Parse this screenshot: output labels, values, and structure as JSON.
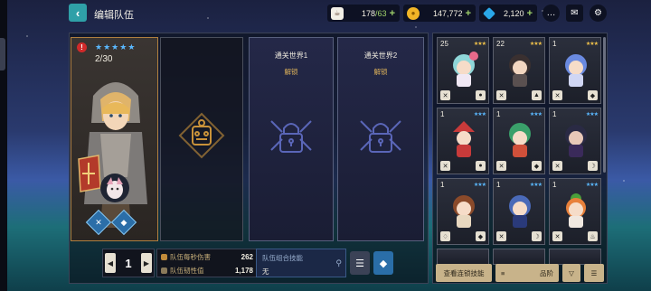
{
  "topbar": {
    "back_icon": "chevron-left-icon",
    "title": "编辑队伍",
    "resources": {
      "stamina": {
        "value": "178",
        "max": "/63",
        "icon": "coffee-icon"
      },
      "gold": {
        "value": "147,772",
        "icon": "gold-coin-icon"
      },
      "gems": {
        "value": "2,120",
        "icon": "gem-icon"
      }
    },
    "icons": [
      "chat-icon",
      "mail-icon",
      "settings-gear-icon"
    ]
  },
  "team": {
    "slots": [
      {
        "type": "hero",
        "level_text": "2/30",
        "star_count": 5,
        "warning": "!"
      },
      {
        "type": "empty",
        "icon": "empty-slot-emblem-icon"
      },
      {
        "type": "locked",
        "title": "通关世界1",
        "status": "解锁",
        "icon": "lock-icon"
      },
      {
        "type": "locked",
        "title": "通关世界2",
        "status": "解锁",
        "icon": "lock-icon"
      }
    ],
    "team_number": "1",
    "stats": [
      {
        "label": "队伍每秒伤害",
        "value": "262"
      },
      {
        "label": "队伍韧性值",
        "value": "1,178"
      }
    ],
    "combo": {
      "label": "队伍组合技能",
      "value": "无"
    }
  },
  "hero_list": [
    {
      "level": "25",
      "stars": "gold",
      "role": "crossed-swords-icon",
      "element": "water-icon"
    },
    {
      "level": "22",
      "stars": "gold",
      "role": "crossed-swords-icon",
      "element": "earth-icon"
    },
    {
      "level": "1",
      "stars": "gold",
      "role": "crossed-swords-icon",
      "element": "basic-icon"
    },
    {
      "level": "1",
      "stars": "blue",
      "role": "crossed-swords-icon",
      "element": "water-icon"
    },
    {
      "level": "1",
      "stars": "blue",
      "role": "crossed-swords-icon",
      "element": "basic-icon"
    },
    {
      "level": "1",
      "stars": "blue",
      "role": "crossed-swords-icon",
      "element": "dark-icon"
    },
    {
      "level": "1",
      "stars": "blue",
      "role": "shield-icon",
      "element": "basic-icon"
    },
    {
      "level": "1",
      "stars": "blue",
      "role": "crossed-swords-icon",
      "element": "dark-icon"
    },
    {
      "level": "1",
      "stars": "blue",
      "role": "crossed-swords-icon",
      "element": "fire-icon"
    }
  ],
  "hero_list_footer": {
    "view_combos": "查看连锁技能",
    "sort_label": "品阶",
    "filter_icon": "filter-icon",
    "options_icon": "sliders-icon"
  }
}
